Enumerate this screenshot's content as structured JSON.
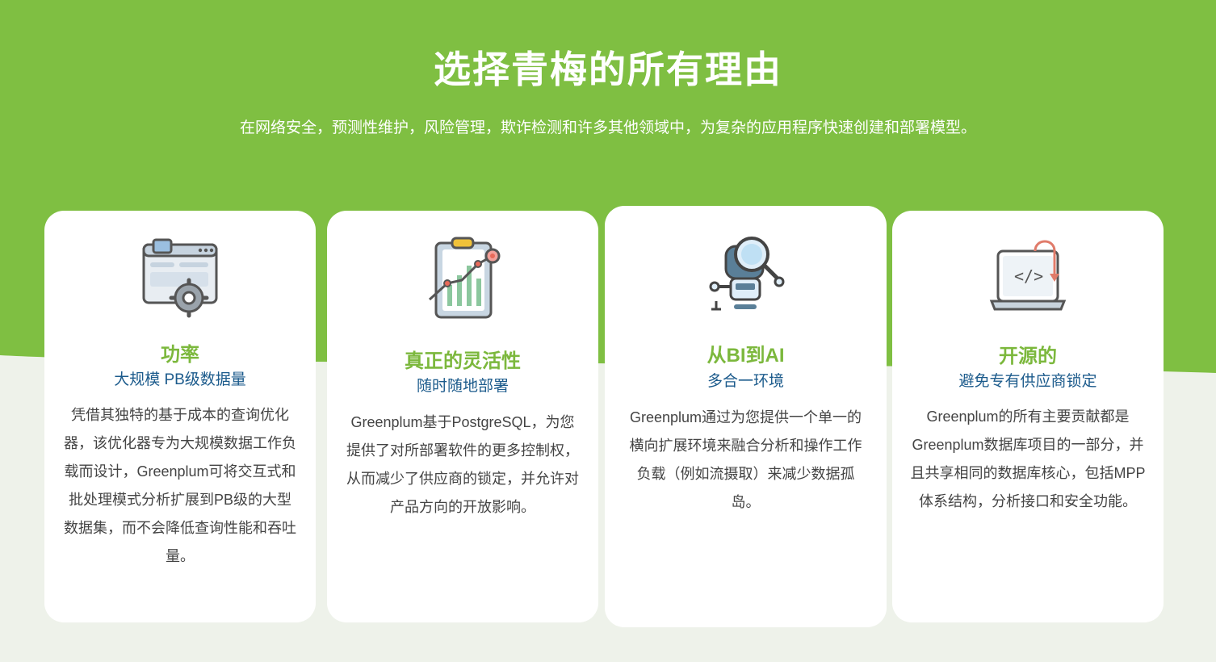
{
  "header": {
    "title": "选择青梅的所有理由",
    "subtitle": "在网络安全，预测性维护，风险管理，欺诈检测和许多其他领域中，为复杂的应用程序快速创建和部署模型。"
  },
  "colors": {
    "green": "#7fbf42",
    "card_title": "#7cb83d",
    "card_sub": "#1c5b8c",
    "body_text": "#444444",
    "bottom_bg": "#eef2ea"
  },
  "cards": [
    {
      "icon": "browser-settings-icon",
      "title": "功率",
      "subtitle": "大规模 PB级数据量",
      "body": "凭借其独特的基于成本的查询优化器，该优化器专为大规模数据工作负载而设计，Greenplum可将交互式和批处理模式分析扩展到PB级的大型数据集，而不会降低查询性能和吞吐量。"
    },
    {
      "icon": "clipboard-chart-icon",
      "title": "真正的灵活性",
      "subtitle": "随时随地部署",
      "body": "Greenplum基于PostgreSQL，为您提供了对所部署软件的更多控制权，从而减少了供应商的锁定，并允许对产品方向的开放影响。"
    },
    {
      "icon": "robot-magnifier-icon",
      "title": "从BI到AI",
      "subtitle": "多合一环境",
      "body": "Greenplum通过为您提供一个单一的横向扩展环境来融合分析和操作工作负载（例如流摄取）来减少数据孤岛。"
    },
    {
      "icon": "laptop-code-icon",
      "title": "开源的",
      "subtitle": "避免专有供应商锁定",
      "body": "Greenplum的所有主要贡献都是Greenplum数据库项目的一部分，并且共享相同的数据库核心，包括MPP体系结构，分析接口和安全功能。"
    }
  ]
}
